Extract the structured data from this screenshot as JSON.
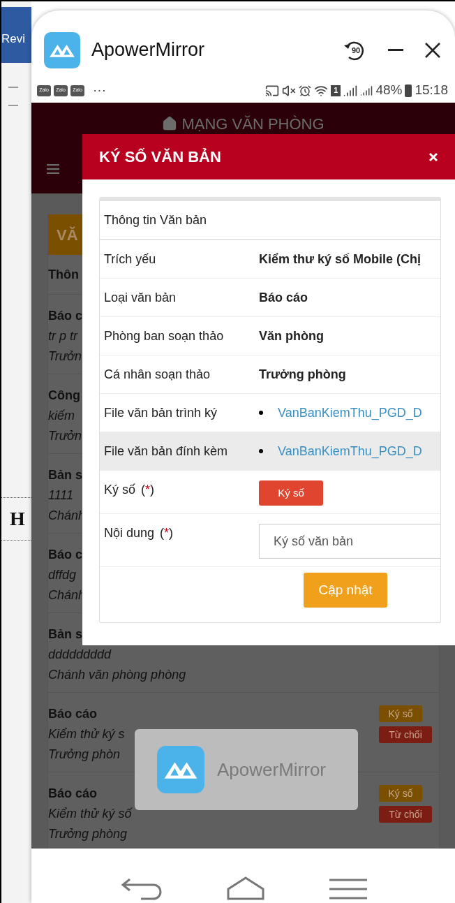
{
  "desktop": {
    "tab_text": "Revi",
    "heading_letter": "H"
  },
  "window": {
    "title": "ApowerMirror",
    "rotate_label": "90"
  },
  "status_bar": {
    "notifications": [
      "Zalo",
      "Zalo",
      "Zalo"
    ],
    "more": "···",
    "sim_slot": "1",
    "battery": "48%",
    "time": "15:18"
  },
  "web": {
    "title": "MẠNG VĂN PHÒNG",
    "panel_title": "VĂ",
    "section": "Thôn",
    "items": [
      {
        "title": "Báo c",
        "line2": "tr p tr",
        "line3": "Trưởn"
      },
      {
        "title": "Công",
        "line2": "kiếm",
        "line3": "Trưởn"
      },
      {
        "title": "Bản s",
        "line2": "1111",
        "line3": "Chánh"
      },
      {
        "title": "Báo c",
        "line2": "dffdg",
        "line3": "Chánh"
      },
      {
        "title": "Bản s",
        "line2": "ddddddddd",
        "line3": "Chánh văn phòng phòng"
      },
      {
        "title": "Báo cáo",
        "line2": "Kiểm thử ký s",
        "line3": "Trưởng phòn",
        "actions": [
          {
            "kind": "sign",
            "label": "Ký số"
          },
          {
            "kind": "reject",
            "label": "Từ chối"
          }
        ]
      },
      {
        "title": "Báo cáo",
        "line2": "Kiểm thử ký số",
        "line3": "Trưởng phòng",
        "actions": [
          {
            "kind": "sign",
            "label": "Ký số"
          },
          {
            "kind": "reject",
            "label": "Từ chối"
          }
        ]
      }
    ]
  },
  "modal": {
    "title": "KÝ SỐ VĂN BẢN",
    "card_title": "Thông tin Văn bản",
    "rows": [
      {
        "kind": "text",
        "label": "Trích yếu",
        "value": "Kiểm thư ký số Mobile (Chị",
        "highlighted": false
      },
      {
        "kind": "text",
        "label": "Loại văn bản",
        "value": "Báo cáo",
        "highlighted": false
      },
      {
        "kind": "text",
        "label": "Phòng ban soạn thảo",
        "value": "Văn phòng",
        "highlighted": false
      },
      {
        "kind": "text",
        "label": "Cá nhân soạn thảo",
        "value": "Trưởng phòng",
        "highlighted": false
      },
      {
        "kind": "file",
        "label": "File văn bản trình ký",
        "value": "VanBanKiemThu_PGD_D",
        "highlighted": false
      },
      {
        "kind": "file",
        "label": "File văn bản đính kèm",
        "value": "VanBanKiemThu_PGD_D",
        "highlighted": true
      },
      {
        "kind": "sign",
        "label": "Ký số",
        "required_mark": [
          "(",
          "*",
          ")"
        ],
        "value": "Ký số",
        "highlighted": false
      },
      {
        "kind": "input",
        "label": "Nội dung",
        "required_mark": [
          "(",
          "*",
          ")"
        ],
        "value": "Ký số văn bản",
        "highlighted": false
      }
    ],
    "submit": "Cập nhật"
  },
  "toast": {
    "title": "ApowerMirror"
  }
}
